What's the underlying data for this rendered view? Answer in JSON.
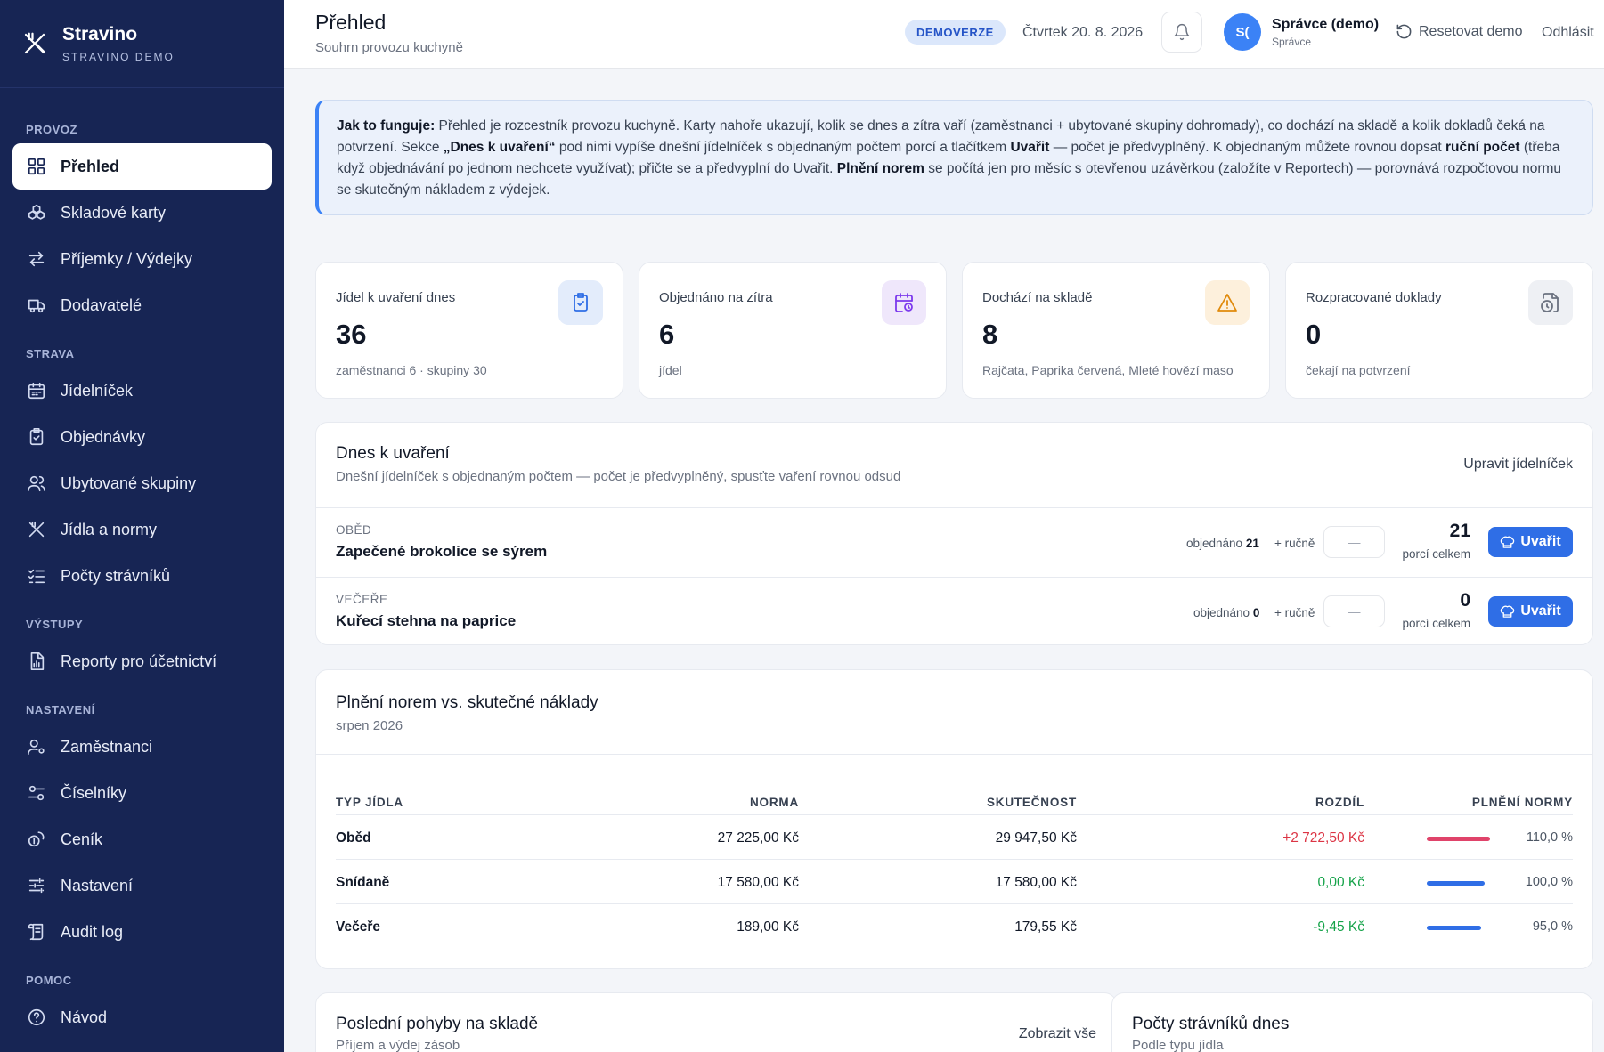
{
  "brand": {
    "name": "Stravino",
    "sub": "STRAVINO DEMO"
  },
  "sidebar": {
    "sections": [
      {
        "label": "PROVOZ",
        "items": [
          {
            "label": "Přehled",
            "icon": "grid-icon",
            "active": true
          },
          {
            "label": "Skladové karty",
            "icon": "boxes-icon"
          },
          {
            "label": "Příjemky / Výdejky",
            "icon": "arrows-swap-icon"
          },
          {
            "label": "Dodavatelé",
            "icon": "truck-icon"
          }
        ]
      },
      {
        "label": "STRAVA",
        "items": [
          {
            "label": "Jídelníček",
            "icon": "calendar-icon"
          },
          {
            "label": "Objednávky",
            "icon": "clipboard-check-icon"
          },
          {
            "label": "Ubytované skupiny",
            "icon": "users-icon"
          },
          {
            "label": "Jídla a normy",
            "icon": "utensils-icon"
          },
          {
            "label": "Počty strávníků",
            "icon": "list-check-icon"
          }
        ]
      },
      {
        "label": "VÝSTUPY",
        "items": [
          {
            "label": "Reporty pro účetnictví",
            "icon": "report-icon"
          }
        ]
      },
      {
        "label": "NASTAVENÍ",
        "items": [
          {
            "label": "Zaměstnanci",
            "icon": "user-gear-icon"
          },
          {
            "label": "Číselníky",
            "icon": "toggles-icon"
          },
          {
            "label": "Ceník",
            "icon": "coins-icon"
          },
          {
            "label": "Nastavení",
            "icon": "sliders-icon"
          },
          {
            "label": "Audit log",
            "icon": "scroll-icon"
          }
        ]
      },
      {
        "label": "POMOC",
        "items": [
          {
            "label": "Návod",
            "icon": "help-icon"
          }
        ]
      }
    ]
  },
  "header": {
    "title": "Přehled",
    "subtitle": "Souhrn provozu kuchyně",
    "badge": "DEMOVERZE",
    "date": "Čtvrtek 20. 8. 2026",
    "avatar_initials": "S(",
    "user_name": "Správce (demo)",
    "user_role": "Správce",
    "reset_label": "Resetovat demo",
    "logout_label": "Odhlásit"
  },
  "info": {
    "lead": "Jak to funguje:",
    "t1": " Přehled je rozcestník provozu kuchyně. Karty nahoře ukazují, kolik se dnes a zítra vaří (zaměstnanci + ubytované skupiny dohromady), co dochází na skladě a kolik dokladů čeká na potvrzení. Sekce ",
    "b1": "„Dnes k uvaření“",
    "t2": " pod nimi vypíše dnešní jídelníček s objednaným počtem porcí a tlačítkem ",
    "b2": "Uvařit",
    "t3": " — počet je předvyplněný. K objednaným můžete rovnou dopsat ",
    "b3": "ruční počet",
    "t4": " (třeba když objednávání po jednom nechcete využívat); přičte se a předvyplní do Uvařit. ",
    "b4": "Plnění norem",
    "t5": " se počítá jen pro měsíc s otevřenou uzávěrkou (založíte v Reportech) — porovnává rozpočtovou normu se skutečným nákladem z výdejek."
  },
  "stats": [
    {
      "label": "Jídel k uvaření dnes",
      "value": "36",
      "note": "zaměstnanci 6 · skupiny 30",
      "icon": "clipboard-check-icon",
      "bg": "#e3ecfb",
      "fg": "#2f6ee6"
    },
    {
      "label": "Objednáno na zítra",
      "value": "6",
      "note": "jídel",
      "icon": "calendar-clock-icon",
      "bg": "#efe7fb",
      "fg": "#7c3aed"
    },
    {
      "label": "Dochází na skladě",
      "value": "8",
      "note": "Rajčata, Paprika červená, Mleté hovězí maso",
      "icon": "warning-icon",
      "bg": "#fdf0dc",
      "fg": "#e08a0b"
    },
    {
      "label": "Rozpracované doklady",
      "value": "0",
      "note": "čekají na potvrzení",
      "icon": "file-clock-icon",
      "bg": "#eef0f4",
      "fg": "#6b7280"
    }
  ],
  "today": {
    "title": "Dnes k uvaření",
    "subtitle": "Dnešní jídelníček s objednaným počtem — počet je předvyplněný, spusťte vaření rovnou odsud",
    "edit_label": "Upravit jídelníček",
    "ordered_label": "objednáno",
    "manual_label": "+ ručně",
    "manual_placeholder": "—",
    "total_label": "porcí celkem",
    "cook_label": "Uvařit",
    "meals": [
      {
        "type": "OBĚD",
        "name": "Zapečené brokolice se sýrem",
        "ordered": "21",
        "total": "21"
      },
      {
        "type": "VEČEŘE",
        "name": "Kuřecí stehna na paprice",
        "ordered": "0",
        "total": "0"
      }
    ]
  },
  "norms": {
    "title": "Plnění norem vs. skutečné náklady",
    "period": "srpen 2026",
    "columns": [
      "TYP JÍDLA",
      "NORMA",
      "SKUTEČNOST",
      "ROZDÍL",
      "PLNĚNÍ NORMY"
    ],
    "rows": [
      {
        "type": "Oběd",
        "norm": "27 225,00 Kč",
        "actual": "29 947,50 Kč",
        "diff": "+2 722,50 Kč",
        "diff_color": "#dc3545",
        "pct": "110,0 %",
        "pct_value": 110.0,
        "bar_color": "#e0436a"
      },
      {
        "type": "Snídaně",
        "norm": "17 580,00 Kč",
        "actual": "17 580,00 Kč",
        "diff": "0,00 Kč",
        "diff_color": "#16a34a",
        "pct": "100,0 %",
        "pct_value": 100.0,
        "bar_color": "#2f6ee6"
      },
      {
        "type": "Večeře",
        "norm": "189,00 Kč",
        "actual": "179,55 Kč",
        "diff": "-9,45 Kč",
        "diff_color": "#16a34a",
        "pct": "95,0 %",
        "pct_value": 95.0,
        "bar_color": "#2f6ee6"
      }
    ]
  },
  "movements": {
    "title": "Poslední pohyby na skladě",
    "subtitle": "Příjem a výdej zásob",
    "view_all": "Zobrazit vše"
  },
  "diners": {
    "title": "Počty strávníků dnes",
    "subtitle": "Podle typu jídla"
  }
}
